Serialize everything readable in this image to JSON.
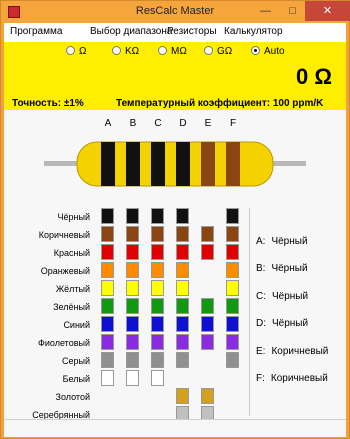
{
  "window": {
    "title": "ResCalc Master",
    "minimize": "—",
    "maximize": "□",
    "close": "✕"
  },
  "menu": [
    "Программа",
    "Выбор диапазона",
    "Резисторы",
    "Калькулятор"
  ],
  "range_options": [
    {
      "label": "Ω",
      "selected": false
    },
    {
      "label": "KΩ",
      "selected": false
    },
    {
      "label": "MΩ",
      "selected": false
    },
    {
      "label": "GΩ",
      "selected": false
    },
    {
      "label": "Auto",
      "selected": true
    }
  ],
  "value_display": "0 Ω",
  "accuracy": "Точность: ±1%",
  "temp_coeff": "Температурный коэффициент: 100 ppm/K",
  "band_columns": [
    "A",
    "B",
    "C",
    "D",
    "E",
    "F"
  ],
  "color_rows": [
    "Чёрный",
    "Коричневый",
    "Красный",
    "Оранжевый",
    "Жёлтый",
    "Зелёный",
    "Синий",
    "Фиолетовый",
    "Серый",
    "Белый",
    "Золотой",
    "Серебрянный"
  ],
  "results": [
    {
      "key": "A:",
      "value": "Чёрный"
    },
    {
      "key": "B:",
      "value": "Чёрный"
    },
    {
      "key": "C:",
      "value": "Чёрный"
    },
    {
      "key": "D:",
      "value": "Чёрный"
    },
    {
      "key": "E:",
      "value": "Коричневый"
    },
    {
      "key": "F:",
      "value": "Коричневый"
    }
  ],
  "colors": {
    "black": "#111111",
    "brown": "#8b4513",
    "red": "#e10000",
    "orange": "#ff8c00",
    "yellow": "#ffff00",
    "green": "#119911",
    "blue": "#1010d0",
    "violet": "#8a2be2",
    "gray": "#909090",
    "white": "#ffffff",
    "gold": "#d4a020",
    "silver": "#c0c0c0",
    "resistor_body": "#f4d200",
    "accent": "#ffee00"
  }
}
